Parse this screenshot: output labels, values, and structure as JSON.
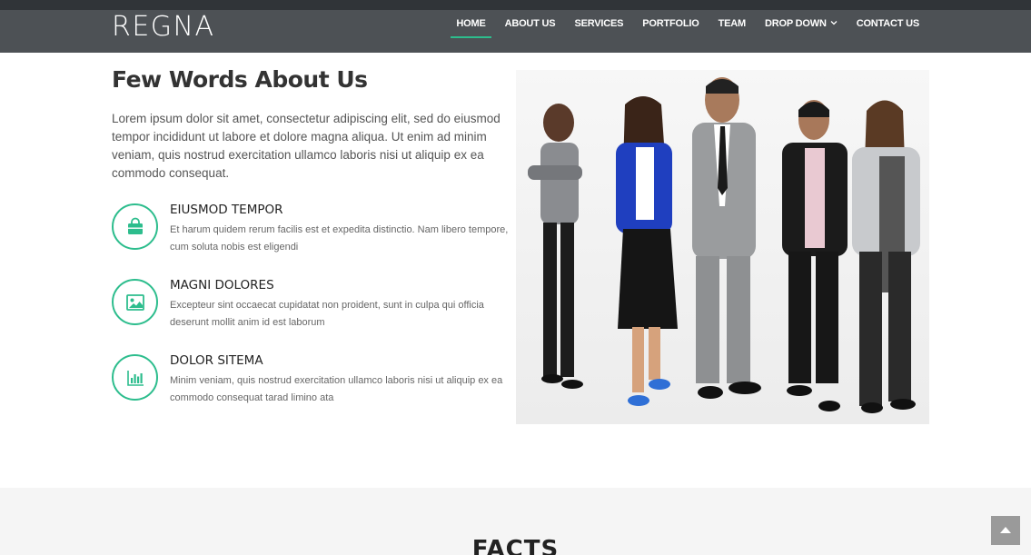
{
  "brand": {
    "logo": "REGNA"
  },
  "nav": {
    "items": [
      {
        "label": "HOME",
        "active": true
      },
      {
        "label": "ABOUT US"
      },
      {
        "label": "SERVICES"
      },
      {
        "label": "PORTFOLIO"
      },
      {
        "label": "TEAM"
      },
      {
        "label": "DROP DOWN",
        "has_dropdown": true
      },
      {
        "label": "CONTACT US"
      }
    ]
  },
  "about": {
    "title": "Few Words About Us",
    "lead": "Lorem ipsum dolor sit amet, consectetur adipiscing elit, sed do eiusmod tempor incididunt ut labore et dolore magna aliqua. Ut enim ad minim veniam, quis nostrud exercitation ullamco laboris nisi ut aliquip ex ea commodo consequat.",
    "features": [
      {
        "icon": "shopping-bag-icon",
        "title": "EIUSMOD TEMPOR",
        "description": "Et harum quidem rerum facilis est et expedita distinctio. Nam libero tempore, cum soluta nobis est eligendi"
      },
      {
        "icon": "image-icon",
        "title": "MAGNI DOLORES",
        "description": "Excepteur sint occaecat cupidatat non proident, sunt in culpa qui officia deserunt mollit anim id est laborum"
      },
      {
        "icon": "bar-chart-icon",
        "title": "DOLOR SITEMA",
        "description": "Minim veniam, quis nostrud exercitation ullamco laboris nisi ut aliquip ex ea commodo consequat tarad limino ata"
      }
    ]
  },
  "facts": {
    "title": "FACTS"
  },
  "colors": {
    "accent": "#2dbd8d",
    "header_bg": "#4d5155",
    "topbar_bg": "#303438"
  }
}
